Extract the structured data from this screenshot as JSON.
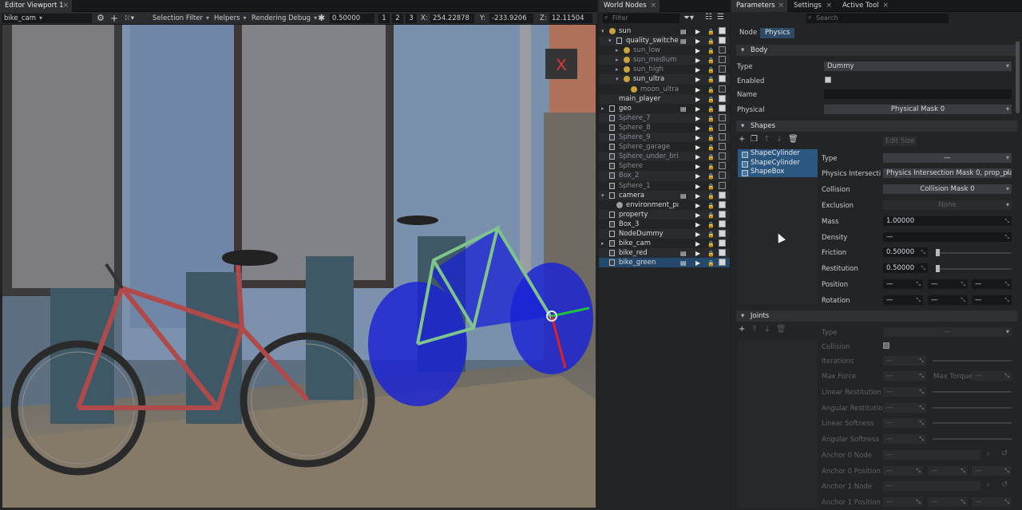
{
  "viewport": {
    "tab_title": "Editor Viewport 1",
    "camera": "bike_cam",
    "selection_filter": "Selection Filter",
    "helpers": "Helpers",
    "rendering_debug": "Rendering Debug",
    "snap_value": "0.50000",
    "presets": [
      "1",
      "2",
      "3"
    ],
    "x_label": "X:",
    "x_value": "254.22878",
    "y_label": "Y:",
    "y_value": "-233.9206",
    "z_label": "Z:",
    "z_value": "12.11504",
    "gizmo_close": "X"
  },
  "world_nodes": {
    "tab_title": "World Nodes",
    "filter_placeholder": "Filter",
    "rows": [
      {
        "label": "sun",
        "indent": 0,
        "expand": "▾",
        "icon": "sun-icon",
        "cols": [
          true,
          false,
          true,
          true
        ]
      },
      {
        "label": "quality_switche",
        "indent": 1,
        "expand": "▾",
        "icon": "box-icon",
        "cols": [
          true,
          false,
          true,
          true
        ]
      },
      {
        "label": "sun_low",
        "indent": 2,
        "expand": "▸",
        "icon": "light-icon",
        "dim": true,
        "cols": [
          false,
          false,
          true,
          false
        ]
      },
      {
        "label": "sun_medium",
        "indent": 2,
        "expand": "▸",
        "icon": "light-icon",
        "dim": true,
        "cols": [
          false,
          false,
          true,
          false
        ]
      },
      {
        "label": "sun_high",
        "indent": 2,
        "expand": "▸",
        "icon": "light-icon",
        "dim": true,
        "cols": [
          false,
          false,
          true,
          false
        ]
      },
      {
        "label": "sun_ultra",
        "indent": 2,
        "expand": "▾",
        "icon": "light-icon",
        "cols": [
          false,
          false,
          true,
          true
        ]
      },
      {
        "label": "moon_ultra",
        "indent": 3,
        "expand": "",
        "icon": "light-icon",
        "dim": true,
        "cols": [
          false,
          false,
          true,
          false
        ]
      },
      {
        "label": "main_player",
        "indent": 0,
        "expand": "",
        "icon": "none",
        "cols": [
          false,
          false,
          true,
          true
        ]
      },
      {
        "label": "geo",
        "indent": 0,
        "expand": "▸",
        "icon": "box-icon",
        "cols": [
          true,
          false,
          true,
          true
        ]
      },
      {
        "label": "Sphere_7",
        "indent": 0,
        "expand": "",
        "icon": "mesh-icon",
        "dim": true,
        "cols": [
          false,
          false,
          true,
          false
        ]
      },
      {
        "label": "Sphere_8",
        "indent": 0,
        "expand": "",
        "icon": "mesh-icon",
        "dim": true,
        "cols": [
          false,
          false,
          true,
          false
        ]
      },
      {
        "label": "Sphere_9",
        "indent": 0,
        "expand": "",
        "icon": "mesh-icon",
        "dim": true,
        "cols": [
          false,
          false,
          true,
          false
        ]
      },
      {
        "label": "Sphere_garage",
        "indent": 0,
        "expand": "",
        "icon": "mesh-icon",
        "dim": true,
        "cols": [
          false,
          false,
          true,
          false
        ]
      },
      {
        "label": "Sphere_under_bri",
        "indent": 0,
        "expand": "",
        "icon": "mesh-icon",
        "dim": true,
        "cols": [
          false,
          false,
          true,
          false
        ]
      },
      {
        "label": "Sphere",
        "indent": 0,
        "expand": "",
        "icon": "mesh-icon",
        "dim": true,
        "cols": [
          false,
          false,
          true,
          false
        ]
      },
      {
        "label": "Box_2",
        "indent": 0,
        "expand": "",
        "icon": "mesh-icon",
        "dim": true,
        "cols": [
          false,
          false,
          true,
          false
        ]
      },
      {
        "label": "Sphere_1",
        "indent": 0,
        "expand": "",
        "icon": "mesh-icon",
        "dim": true,
        "cols": [
          false,
          false,
          true,
          false
        ]
      },
      {
        "label": "camera",
        "indent": 0,
        "expand": "▾",
        "icon": "box-icon",
        "cols": [
          true,
          false,
          true,
          true
        ]
      },
      {
        "label": "environment_pı",
        "indent": 1,
        "expand": "",
        "icon": "env-icon",
        "cols": [
          false,
          false,
          true,
          true
        ]
      },
      {
        "label": "property",
        "indent": 0,
        "expand": "",
        "icon": "box-icon",
        "cols": [
          false,
          false,
          true,
          true
        ]
      },
      {
        "label": "Box_3",
        "indent": 0,
        "expand": "",
        "icon": "mesh-icon",
        "cols": [
          false,
          false,
          true,
          true
        ]
      },
      {
        "label": "NodeDummy",
        "indent": 0,
        "expand": "",
        "icon": "box-icon",
        "cols": [
          false,
          false,
          true,
          true
        ]
      },
      {
        "label": "bike_cam",
        "indent": 0,
        "expand": "▸",
        "icon": "mesh-icon",
        "cols": [
          false,
          false,
          true,
          true
        ]
      },
      {
        "label": "bike_red",
        "indent": 0,
        "expand": "",
        "icon": "mesh-icon",
        "cols": [
          true,
          false,
          true,
          true
        ]
      },
      {
        "label": "bike_green",
        "indent": 0,
        "expand": "",
        "icon": "mesh-icon",
        "selected": true,
        "cols": [
          true,
          false,
          true,
          true
        ]
      }
    ]
  },
  "parameters": {
    "tabs": [
      {
        "label": "Parameters",
        "active": true
      },
      {
        "label": "Settings",
        "active": false
      },
      {
        "label": "Active Tool",
        "active": false
      }
    ],
    "search_placeholder": "Search",
    "subtabs": [
      "Node",
      "Physics"
    ],
    "body": {
      "section": "Body",
      "type_label": "Type",
      "type_value": "Dummy",
      "enabled_label": "Enabled",
      "name_label": "Name",
      "name_value": "",
      "physical_label": "Physical",
      "physical_value": "Physical Mask 0"
    },
    "shapes": {
      "section": "Shapes",
      "items": [
        "ShapeCylinder",
        "ShapeCylinder",
        "ShapeBox"
      ],
      "edit_size": "Edit Size",
      "type_label": "Type",
      "type_value": "—",
      "intersection_label": "Physics Intersecti",
      "intersection_value": "Physics Intersection Mask 0, prop_pla...",
      "collision_label": "Collision",
      "collision_value": "Collision Mask 0",
      "exclusion_label": "Exclusion",
      "exclusion_value": "None",
      "mass_label": "Mass",
      "mass_value": "1.00000",
      "density_label": "Density",
      "density_value": "—",
      "friction_label": "Friction",
      "friction_value": "0.50000",
      "restitution_label": "Restitution",
      "restitution_value": "0.50000",
      "position_label": "Position",
      "rotation_label": "Rotation",
      "vector_value": "—"
    },
    "joints": {
      "section": "Joints",
      "type_label": "Type",
      "type_value": "—",
      "collision_label": "Collision",
      "iterations_label": "Iterations",
      "max_force_label": "Max Force",
      "max_torque_label": "Max Torque",
      "linear_restitution_label": "Linear Restitution",
      "angular_restitution_label": "Angular Restitution",
      "linear_softness_label": "Linear Softness",
      "angular_softness_label": "Angular Softness",
      "anchor0_node_label": "Anchor 0 Node",
      "anchor0_position_label": "Anchor 0 Position",
      "anchor1_node_label": "Anchor 1 Node",
      "anchor1_position_label": "Anchor 1 Position",
      "value": "—"
    }
  },
  "colors": {
    "selection": "#2b5780",
    "gizmo_blue": "#1a22d6",
    "bike_red": "#b04a4a",
    "bike_green": "#5a8f4a"
  }
}
